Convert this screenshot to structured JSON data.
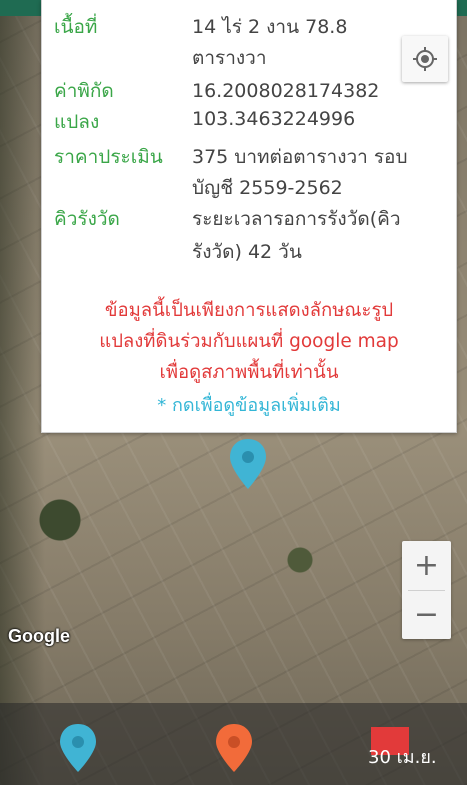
{
  "info_card": {
    "fields": [
      {
        "label": "เนื้อที่",
        "value_line1": "14  ไร่  2  งาน  78.8",
        "value_line2": "ตารางวา"
      },
      {
        "label_line1": "ค่าพิกัด",
        "label_line2": "แปลง",
        "value_line1": "16.2008028174382",
        "value_line2": "103.3463224996"
      },
      {
        "label": "ราคาประเมิน",
        "value_line1": "375 บาทต่อตารางวา รอบ",
        "value_line2": "บัญชี 2559-2562"
      },
      {
        "label": "คิวรังวัด",
        "value_line1": "ระยะเวลารอการรังวัด(คิว",
        "value_line2": "รังวัด) 42 วัน"
      }
    ],
    "notice_lines": [
      "ข้อมูลนี้เป็นเพียงการแสดงลักษณะรูป",
      "แปลงที่ดินร่วมกับแผนที่ google map",
      "เพื่อดูสภาพพื้นที่เท่านั้น"
    ],
    "more_link": "* กดเพื่อดูข้อมูลเพิ่มเติม"
  },
  "map": {
    "attribution": "Google",
    "zoom_in": "+",
    "zoom_out": "−"
  },
  "bottom_bar": {
    "date": "30 เม.ย."
  },
  "icons": {
    "locate": "my-location-icon",
    "map_pin": "map-marker-icon"
  },
  "colors": {
    "label_green": "#3aa648",
    "notice_red": "#e23a3a",
    "link_cyan": "#33b6d6",
    "pin_blue": "#40b4d4",
    "pin_orange": "#f26b3a"
  }
}
